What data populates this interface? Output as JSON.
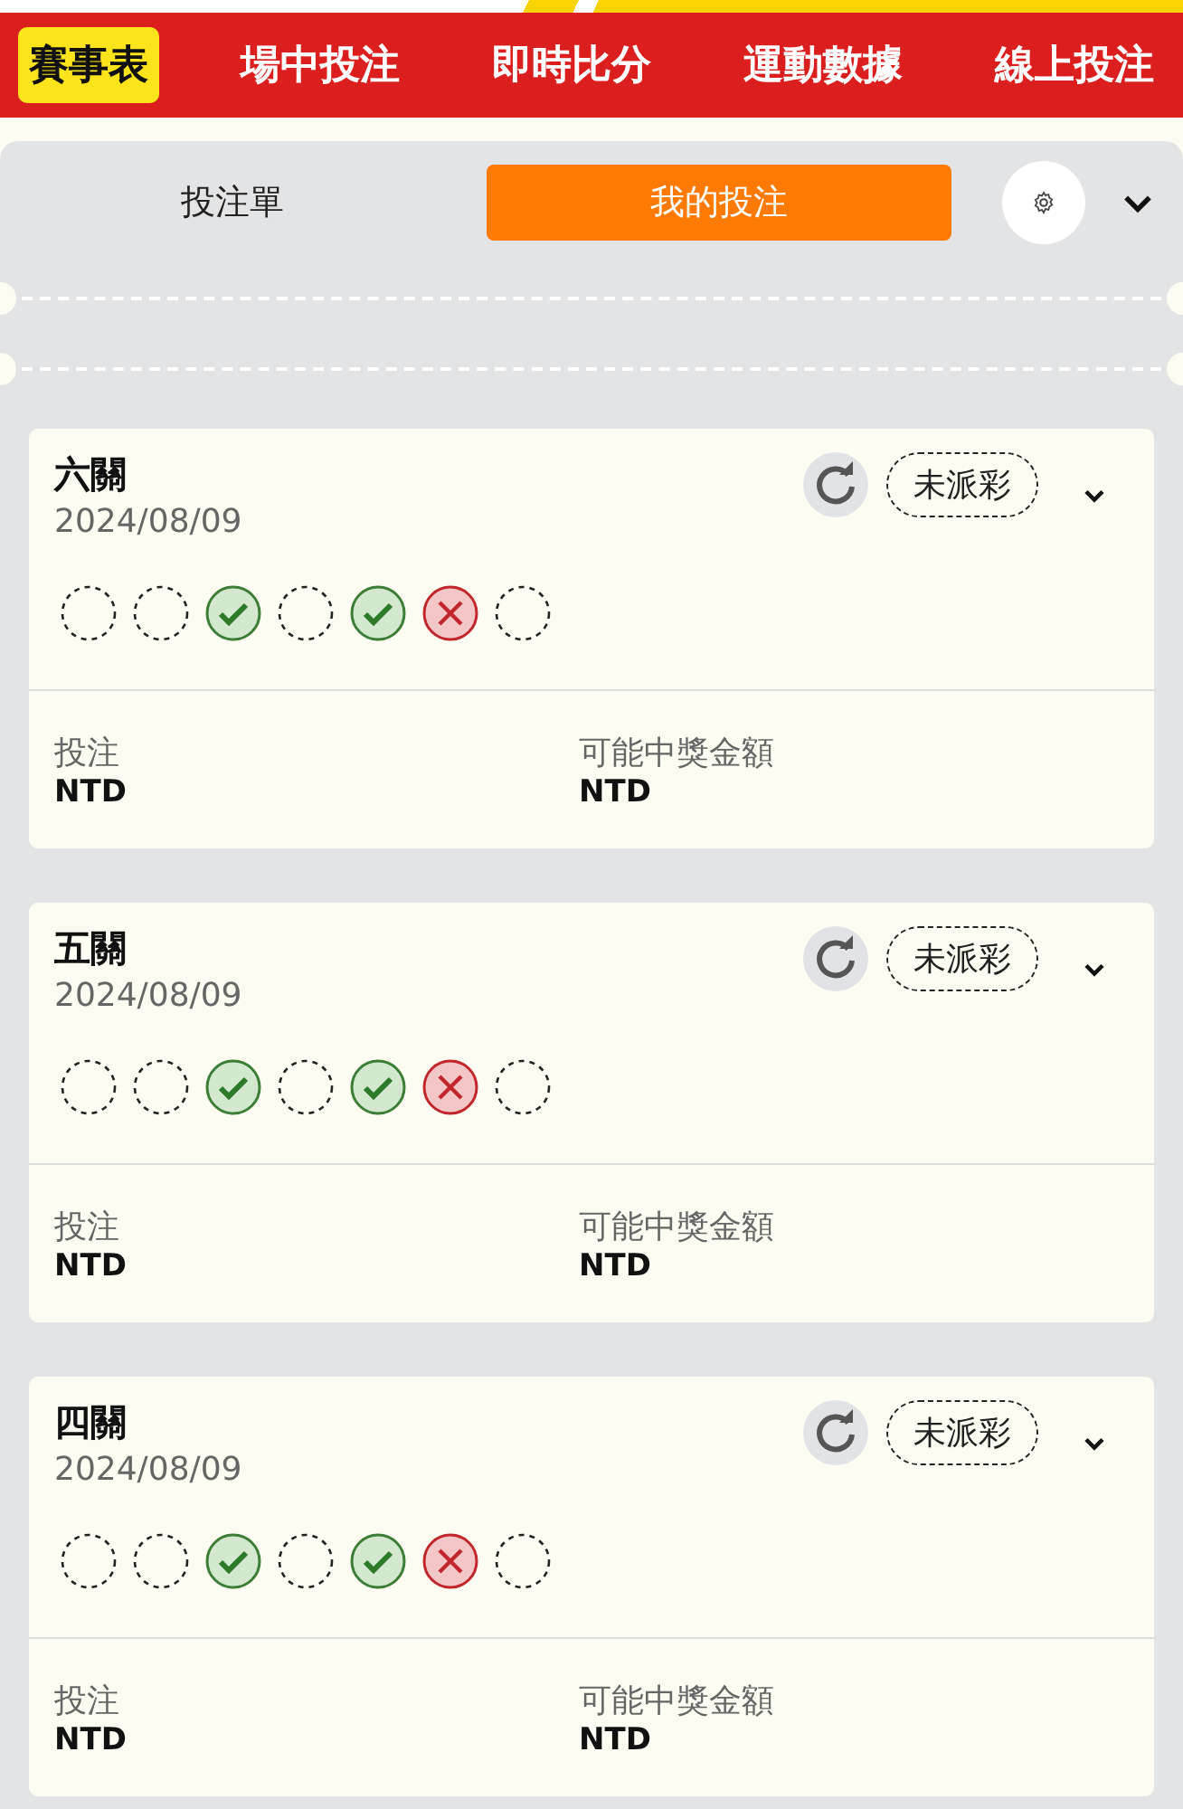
{
  "nav_tabs": [
    {
      "label": "賽事表",
      "selected": true
    },
    {
      "label": "場中投注",
      "selected": false
    },
    {
      "label": "即時比分",
      "selected": false
    },
    {
      "label": "運動數據",
      "selected": false
    },
    {
      "label": "線上投注",
      "selected": false
    }
  ],
  "bet_tabs": [
    {
      "label": "投注單",
      "selected": false
    },
    {
      "label": "我的投注",
      "selected": true
    }
  ],
  "bets": [
    {
      "title": "六關",
      "date": "2024/08/09",
      "status": "未派彩",
      "legs": [
        {
          "kind": "pending"
        },
        {
          "kind": "pending"
        },
        {
          "kind": "won"
        },
        {
          "kind": "pending"
        },
        {
          "kind": "won"
        },
        {
          "kind": "lost"
        },
        {
          "kind": "pending"
        }
      ],
      "stake_label": "投注",
      "stake_value": "NTD",
      "payout_label": "可能中獎金額",
      "payout_value": "NTD"
    },
    {
      "title": "五關",
      "date": "2024/08/09",
      "status": "未派彩",
      "legs": [
        {
          "kind": "pending"
        },
        {
          "kind": "pending"
        },
        {
          "kind": "won"
        },
        {
          "kind": "pending"
        },
        {
          "kind": "won"
        },
        {
          "kind": "lost"
        },
        {
          "kind": "pending"
        }
      ],
      "stake_label": "投注",
      "stake_value": "NTD",
      "payout_label": "可能中獎金額",
      "payout_value": "NTD"
    },
    {
      "title": "四關",
      "date": "2024/08/09",
      "status": "未派彩",
      "legs": [
        {
          "kind": "pending"
        },
        {
          "kind": "pending"
        },
        {
          "kind": "won"
        },
        {
          "kind": "pending"
        },
        {
          "kind": "won"
        },
        {
          "kind": "lost"
        },
        {
          "kind": "pending"
        }
      ],
      "stake_label": "投注",
      "stake_value": "NTD",
      "payout_label": "可能中獎金額",
      "payout_value": "NTD"
    }
  ]
}
